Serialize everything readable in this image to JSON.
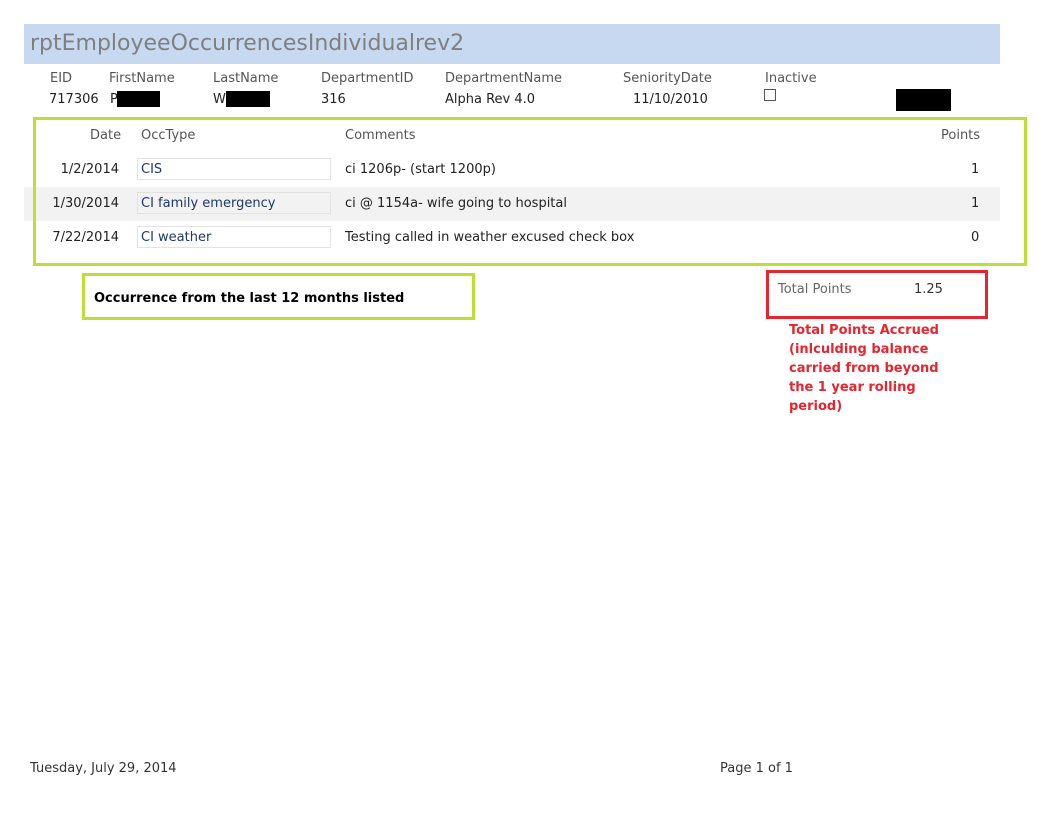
{
  "report": {
    "title": "rptEmployeeOccurrencesIndividualrev2"
  },
  "employee": {
    "headers": {
      "eid": "EID",
      "first_name": "FirstName",
      "last_name": "LastName",
      "department_id": "DepartmentID",
      "department_name": "DepartmentName",
      "seniority_date": "SeniorityDate",
      "inactive": "Inactive"
    },
    "values": {
      "eid": "717306",
      "first_name": "P",
      "last_name": "W",
      "department_id": "316",
      "department_name": "Alpha Rev 4.0",
      "seniority_date": "11/10/2010",
      "inactive": false
    }
  },
  "occurrences": {
    "headers": {
      "date": "Date",
      "occ_type": "OccType",
      "comments": "Comments",
      "points": "Points"
    },
    "rows": [
      {
        "date": "1/2/2014",
        "occ_type": "CIS",
        "comments": "ci 1206p- (start 1200p)",
        "points": "1"
      },
      {
        "date": "1/30/2014",
        "occ_type": "CI family emergency",
        "comments": "ci @ 1154a- wife going to hospital",
        "points": "1"
      },
      {
        "date": "7/22/2014",
        "occ_type": "CI weather",
        "comments": "Testing called in weather excused check box",
        "points": "0"
      }
    ]
  },
  "annotations": {
    "occurrence_note": "Occurrence from the last 12 months listed",
    "total_points_note": "Total Points Accrued (inlculding balance carried from beyond the 1 year rolling period)",
    "green": "#bedd35",
    "red": "#e3262f"
  },
  "totals": {
    "label": "Total Points",
    "value": "1.25"
  },
  "footer": {
    "date": "Tuesday, July 29, 2014",
    "page": "Page 1 of 1"
  }
}
